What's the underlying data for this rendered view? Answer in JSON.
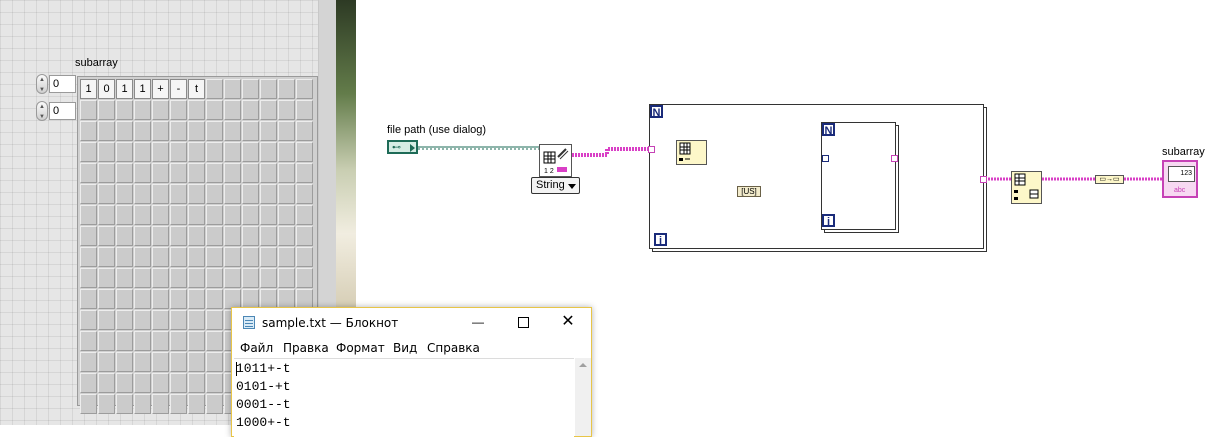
{
  "front_panel": {
    "array_label": "subarray",
    "index_0": "0",
    "index_1": "0",
    "array_elements": [
      "1",
      "0",
      "1",
      "1",
      "+",
      "-",
      "t"
    ]
  },
  "block_diagram": {
    "file_path_label": "file path (use dialog)",
    "read_spreadsheet_type": "String",
    "concat_label": "[US]",
    "for_loop_count_label": "N",
    "for_loop_index_label": "i",
    "unbundle_label": "▭→▭",
    "indicator_label": "subarray",
    "indicator_type": "123",
    "indicator_subtype": "abc"
  },
  "notepad": {
    "title": "sample.txt — Блокнот",
    "minimize": "—",
    "close": "✕",
    "menu": [
      "Файл",
      "Правка",
      "Формат",
      "Вид",
      "Справка"
    ],
    "lines": [
      "1011+-t",
      "0101-+t",
      "0001--t",
      "1000+-t"
    ]
  },
  "colors": {
    "string_wire": "#d93fc6",
    "path_wire": "#1e6b57",
    "numeric_wire": "#1a2b7a",
    "loop_badge": "#1a2b7a"
  }
}
